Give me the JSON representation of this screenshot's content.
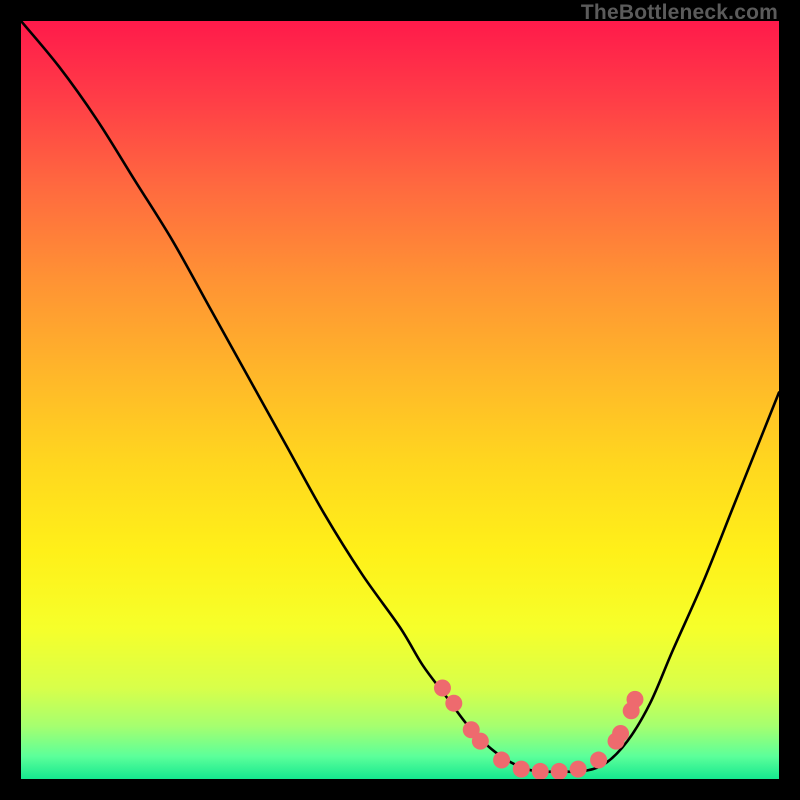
{
  "attribution": "TheBottleneck.com",
  "colors": {
    "frame": "#000000",
    "curve": "#000000",
    "marker": "#ee6a6e",
    "gradient_top": "#ff1a4b",
    "gradient_bottom": "#15e88f"
  },
  "chart_data": {
    "type": "line",
    "title": "",
    "xlabel": "",
    "ylabel": "",
    "xlim": [
      0,
      100
    ],
    "ylim": [
      0,
      100
    ],
    "note": "x is horizontal position (0=left,100=right) inside the plot; y is bottleneck % (0=bottom green, 100=top red). Curve is estimated from pixels.",
    "series": [
      {
        "name": "bottleneck-curve",
        "x": [
          0,
          5,
          10,
          15,
          20,
          25,
          30,
          35,
          40,
          45,
          50,
          53,
          56,
          59,
          62,
          65,
          68,
          71,
          74,
          77,
          80,
          83,
          86,
          90,
          94,
          98,
          100
        ],
        "y": [
          100,
          94,
          87,
          79,
          71,
          62,
          53,
          44,
          35,
          27,
          20,
          15,
          11,
          7,
          4,
          2,
          1,
          1,
          1,
          2,
          5,
          10,
          17,
          26,
          36,
          46,
          51
        ]
      }
    ],
    "markers": {
      "name": "valley-points",
      "x": [
        55.6,
        57.1,
        59.4,
        60.6,
        63.4,
        66.0,
        68.5,
        71.0,
        73.5,
        76.2,
        78.5,
        79.1,
        80.5,
        81.0
      ],
      "y": [
        12.0,
        10.0,
        6.5,
        5.0,
        2.5,
        1.3,
        1.0,
        1.0,
        1.3,
        2.5,
        5.0,
        6.0,
        9.0,
        10.5
      ]
    }
  }
}
